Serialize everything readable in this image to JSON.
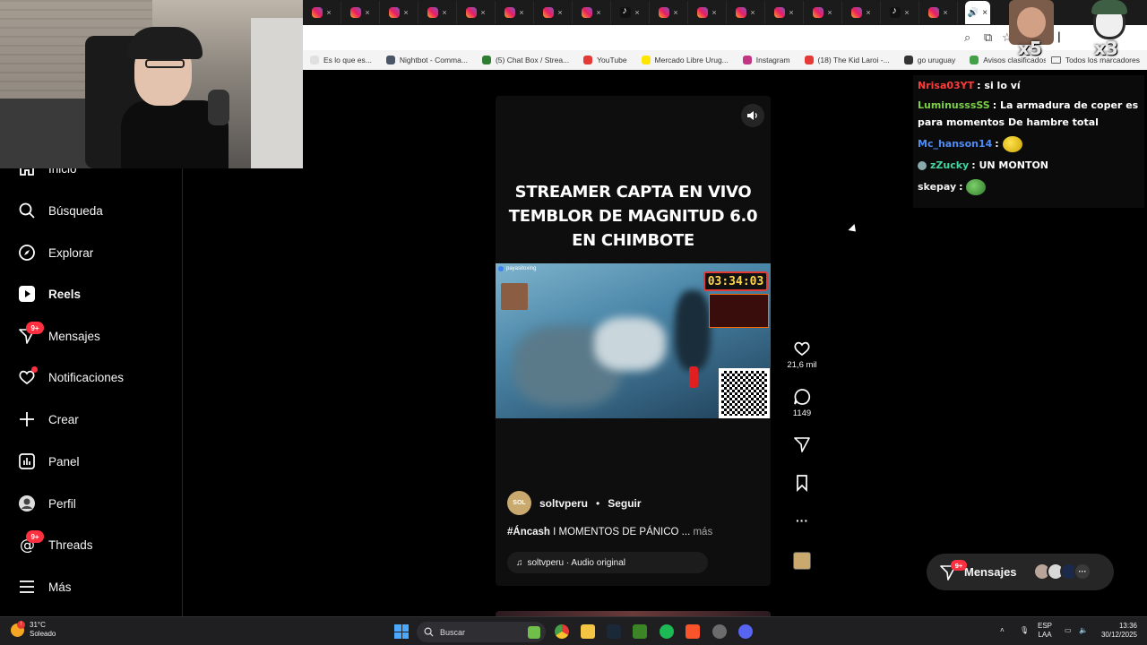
{
  "bookmarks": [
    {
      "label": "Es lo que es...",
      "color": "#e0e0e0"
    },
    {
      "label": "Nightbot - Comma...",
      "color": "#4a5568"
    },
    {
      "label": "(5) Chat Box / Strea...",
      "color": "#2e7d32"
    },
    {
      "label": "YouTube",
      "color": "#e53935"
    },
    {
      "label": "Mercado Libre Urug...",
      "color": "#ffe600"
    },
    {
      "label": "Instagram",
      "color": "#c13584"
    },
    {
      "label": "(18) The Kid Laroi -...",
      "color": "#e53935"
    },
    {
      "label": "go uruguay",
      "color": "#333333"
    },
    {
      "label": "Avisos clasificados g...",
      "color": "#43a047"
    }
  ],
  "bookmarks_folder": "Todos los marcadores",
  "overlay": {
    "mult_left": "x5",
    "mult_right": "x3"
  },
  "sidebar": {
    "items": [
      {
        "label": "Inicio",
        "icon": "home-icon"
      },
      {
        "label": "Búsqueda",
        "icon": "search-icon"
      },
      {
        "label": "Explorar",
        "icon": "compass-icon"
      },
      {
        "label": "Reels",
        "icon": "reels-icon"
      },
      {
        "label": "Mensajes",
        "icon": "messenger-icon",
        "badge": "9+"
      },
      {
        "label": "Notificaciones",
        "icon": "heart-icon"
      },
      {
        "label": "Crear",
        "icon": "plus-icon"
      },
      {
        "label": "Panel",
        "icon": "chart-icon"
      },
      {
        "label": "Perfil",
        "icon": "profile-icon"
      },
      {
        "label": "Threads",
        "icon": "threads-icon",
        "badge": "9+"
      },
      {
        "label": "Más",
        "icon": "menu-icon"
      }
    ]
  },
  "reel": {
    "title": "STREAMER CAPTA EN VIVO\nTEMBLOR DE MAGNITUD 6.0\nEN CHIMBOTE",
    "video_timer": "03:34:03",
    "video_handle": "payasitoxing",
    "account": "soltvperu",
    "account_logo": "SOL",
    "follow": "Seguir",
    "dot": "•",
    "caption_tag": "#Áncash",
    "caption_text": " I MOMENTOS DE PÁNICO ...",
    "caption_more": " más",
    "audio": "soltvperu · Audio original"
  },
  "actions": {
    "likes": "21,6 mil",
    "comments": "1149"
  },
  "chat": [
    {
      "user": "Nrisa03YT",
      "color": "#ff3b3b",
      "text": "si lo ví"
    },
    {
      "user": "LuminusssSS",
      "color": "#7bd148",
      "text": "La armadura de coper es para momentos De hambre total"
    },
    {
      "user": "Mc_hanson14",
      "color": "#4f8df5",
      "text": ""
    },
    {
      "user": "zZucky",
      "color": "#3fd6a0",
      "text": "UN MONTON"
    },
    {
      "user": "skepay",
      "color": "#f0f0f0",
      "text": ""
    }
  ],
  "chat_sep": ":",
  "messages_pill": {
    "label": "Mensajes",
    "badge": "9+"
  },
  "taskbar": {
    "temp": "31°C",
    "weather": "Soleado",
    "search": "Buscar",
    "lang1": "ESP",
    "lang2": "LAA",
    "time": "13:36",
    "date": "30/12/2025"
  },
  "colors": {
    "badge": "#ff3040",
    "accent": "#4f8df5"
  }
}
